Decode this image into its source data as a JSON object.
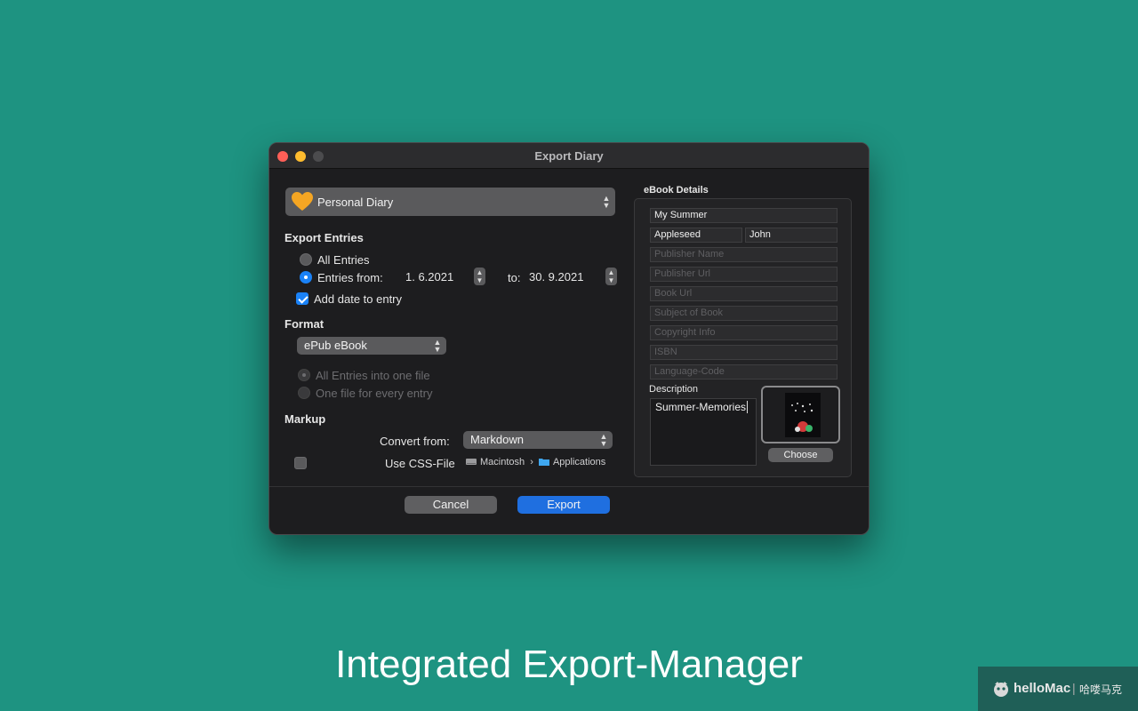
{
  "window": {
    "title": "Export Diary"
  },
  "journal_select": {
    "value": "Personal Diary",
    "icon": "heart-icon"
  },
  "export_entries": {
    "heading": "Export Entries",
    "all_label": "All Entries",
    "from_label": "Entries from:",
    "from_value": "1.  6.2021",
    "to_label": "to:",
    "to_value": "30.  9.2021",
    "add_date_label": "Add date to entry"
  },
  "format": {
    "heading": "Format",
    "value": "ePub eBook",
    "one_file_label": "All Entries into one file",
    "each_file_label": "One file for every entry"
  },
  "markup": {
    "heading": "Markup",
    "convert_label": "Convert from:",
    "convert_value": "Markdown",
    "css_label": "Use CSS-File",
    "path_disk": "Macintosh",
    "path_sep": "›",
    "path_folder": "Applications"
  },
  "ebook": {
    "heading": "eBook Details",
    "title": "My Summer",
    "last_name": "Appleseed",
    "first_name": "John",
    "publisher_name_ph": "Publisher Name",
    "publisher_url_ph": "Publisher Url",
    "book_url_ph": "Book Url",
    "subject_ph": "Subject of Book",
    "copyright_ph": "Copyright Info",
    "isbn_ph": "ISBN",
    "language_ph": "Language-Code",
    "description_label": "Description",
    "description": "Summer-Memories",
    "choose_label": "Choose"
  },
  "actions": {
    "cancel": "Cancel",
    "export": "Export"
  },
  "caption": "Integrated Export-Manager",
  "watermark": {
    "brand": "helloMac",
    "sep": "|",
    "cn": "哈喽马克"
  },
  "colors": {
    "background": "#1e9381",
    "accent": "#1f6fe0"
  }
}
